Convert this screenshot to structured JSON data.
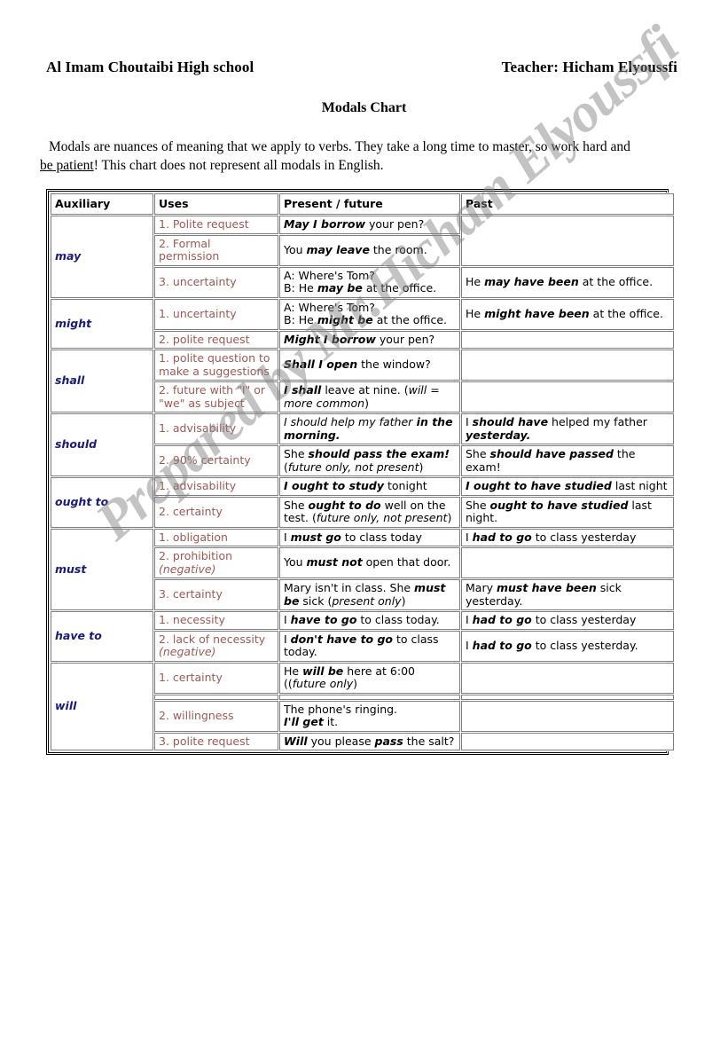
{
  "header": {
    "school": "Al Imam Choutaibi High school",
    "teacher": "Teacher: Hicham Elyoussfi",
    "title": "Modals Chart"
  },
  "intro": {
    "line1": "Modals are nuances of meaning that we apply to verbs. They take a long time to master, so work hard and",
    "line2_underlined": "be patient",
    "line2_rest": "! This chart does not represent all modals in English."
  },
  "watermark": {
    "text": "Prepared by Mr.Hicham Elyoussfi",
    "color": "#828282"
  },
  "colors": {
    "auxiliary_text": "#1a1a7a",
    "uses_text": "#9c5a55",
    "body_text": "#000000",
    "border": "#7d7d7d"
  },
  "table": {
    "columns": [
      "Auxiliary",
      "Uses",
      "Present / future",
      "Past"
    ],
    "groups": [
      {
        "auxiliary": "may",
        "rows": [
          {
            "use": "1. Polite request",
            "present": [
              {
                "t": "May I borrow",
                "s": "bi"
              },
              {
                "t": " your pen?",
                "s": ""
              }
            ],
            "past": [],
            "past_rowspan": 2
          },
          {
            "use": "2. Formal permission",
            "present": [
              {
                "t": "You ",
                "s": ""
              },
              {
                "t": "may leave",
                "s": "bi"
              },
              {
                "t": " the room.",
                "s": ""
              }
            ],
            "past": null
          },
          {
            "use": "3. uncertainty",
            "present": [
              {
                "t": "A: Where's Tom?",
                "s": ""
              },
              {
                "t": "\n",
                "s": "br"
              },
              {
                "t": "B: He ",
                "s": ""
              },
              {
                "t": "may be",
                "s": "bi"
              },
              {
                "t": " at the office.",
                "s": ""
              }
            ],
            "past": [
              {
                "t": "He ",
                "s": ""
              },
              {
                "t": "may have been",
                "s": "bi"
              },
              {
                "t": " at the office.",
                "s": ""
              }
            ]
          }
        ]
      },
      {
        "auxiliary": "might",
        "rows": [
          {
            "use": "1. uncertainty",
            "present": [
              {
                "t": "A: Where's Tom?",
                "s": ""
              },
              {
                "t": "\n",
                "s": "br"
              },
              {
                "t": "B: He ",
                "s": ""
              },
              {
                "t": "might be",
                "s": "bi"
              },
              {
                "t": " at the office.",
                "s": ""
              }
            ],
            "past": [
              {
                "t": "He ",
                "s": ""
              },
              {
                "t": "might have been",
                "s": "bi"
              },
              {
                "t": " at the office.",
                "s": ""
              }
            ]
          },
          {
            "use": "2. polite request",
            "present": [
              {
                "t": "Might I borrow",
                "s": "bi"
              },
              {
                "t": " your pen?",
                "s": ""
              }
            ],
            "past": []
          }
        ]
      },
      {
        "auxiliary": "shall",
        "rows": [
          {
            "use": "1. polite question to make a suggestions",
            "present": [
              {
                "t": "Shall I open",
                "s": "bi"
              },
              {
                "t": " the window?",
                "s": ""
              }
            ],
            "past": []
          },
          {
            "use": "2. future with \"I\" or \"we\" as subject",
            "present": [
              {
                "t": "I shall",
                "s": "bi"
              },
              {
                "t": " leave at nine. (",
                "s": ""
              },
              {
                "t": "will = more common",
                "s": "i"
              },
              {
                "t": ")",
                "s": ""
              }
            ],
            "past": []
          }
        ]
      },
      {
        "auxiliary": "should",
        "rows": [
          {
            "use": "1. advisability",
            "present": [
              {
                "t": "I should help my father",
                "s": "i"
              },
              {
                "t": " in the morning.",
                "s": "b"
              }
            ],
            "past": [
              {
                "t": "I ",
                "s": ""
              },
              {
                "t": "should have",
                "s": "bi"
              },
              {
                "t": " helped my father ",
                "s": ""
              },
              {
                "t": "yesterday.",
                "s": "b"
              }
            ]
          },
          {
            "use": "2. 90% certainty",
            "present": [
              {
                "t": "She ",
                "s": ""
              },
              {
                "t": "should pass the exam!",
                "s": "bi"
              },
              {
                "t": " (",
                "s": ""
              },
              {
                "t": "future only, not present",
                "s": "i"
              },
              {
                "t": ")",
                "s": ""
              }
            ],
            "past": [
              {
                "t": "She ",
                "s": ""
              },
              {
                "t": "should have passed",
                "s": "bi"
              },
              {
                "t": " the exam!",
                "s": ""
              }
            ]
          }
        ]
      },
      {
        "auxiliary": "ought to",
        "rows": [
          {
            "use": "1. advisability",
            "present": [
              {
                "t": "I ought to study",
                "s": "bi"
              },
              {
                "t": " tonight",
                "s": ""
              }
            ],
            "past": [
              {
                "t": "I ought to have studied",
                "s": "bi"
              },
              {
                "t": " last night",
                "s": ""
              }
            ]
          },
          {
            "use": "2. certainty",
            "present": [
              {
                "t": "She ",
                "s": ""
              },
              {
                "t": "ought to do",
                "s": "bi"
              },
              {
                "t": " well on the test. (",
                "s": ""
              },
              {
                "t": "future only, not present",
                "s": "i"
              },
              {
                "t": ")",
                "s": ""
              }
            ],
            "past": [
              {
                "t": "She ",
                "s": ""
              },
              {
                "t": "ought to have studied",
                "s": "bi"
              },
              {
                "t": " last night.",
                "s": ""
              }
            ]
          }
        ]
      },
      {
        "auxiliary": "must",
        "rows": [
          {
            "use": "1. obligation",
            "present": [
              {
                "t": "I ",
                "s": ""
              },
              {
                "t": "must go",
                "s": "bi"
              },
              {
                "t": " to class today",
                "s": ""
              }
            ],
            "past": [
              {
                "t": "I ",
                "s": ""
              },
              {
                "t": "had to go",
                "s": "bi"
              },
              {
                "t": " to class yesterday",
                "s": ""
              }
            ]
          },
          {
            "use": "2. prohibition (negative)",
            "use_italic_tail": "(negative)",
            "present": [
              {
                "t": "You ",
                "s": ""
              },
              {
                "t": "must not",
                "s": "bi"
              },
              {
                "t": " open that door.",
                "s": ""
              }
            ],
            "past": []
          },
          {
            "use": "3. certainty",
            "present": [
              {
                "t": "Mary isn't in class. She ",
                "s": ""
              },
              {
                "t": "must be",
                "s": "bi"
              },
              {
                "t": " sick (",
                "s": ""
              },
              {
                "t": "present only",
                "s": "i"
              },
              {
                "t": ")",
                "s": ""
              }
            ],
            "past": [
              {
                "t": "Mary ",
                "s": ""
              },
              {
                "t": "must have been",
                "s": "bi"
              },
              {
                "t": " sick yesterday.",
                "s": ""
              }
            ]
          }
        ]
      },
      {
        "auxiliary": "have to",
        "rows": [
          {
            "use": "1. necessity",
            "present": [
              {
                "t": "I ",
                "s": ""
              },
              {
                "t": "have to go",
                "s": "bi"
              },
              {
                "t": " to class today.",
                "s": ""
              }
            ],
            "past": [
              {
                "t": "I ",
                "s": ""
              },
              {
                "t": "had to go",
                "s": "bi"
              },
              {
                "t": " to class yesterday",
                "s": ""
              }
            ]
          },
          {
            "use": "2. lack of necessity (negative)",
            "use_italic_tail": "(negative)",
            "present": [
              {
                "t": "I ",
                "s": ""
              },
              {
                "t": "don't have to go",
                "s": "bi"
              },
              {
                "t": " to class today.",
                "s": ""
              }
            ],
            "past": [
              {
                "t": "I ",
                "s": ""
              },
              {
                "t": "had to go",
                "s": "bi"
              },
              {
                "t": " to class yesterday.",
                "s": ""
              }
            ]
          }
        ]
      },
      {
        "auxiliary": "will",
        "rows": [
          {
            "use": "1.  certainty",
            "present": [
              {
                "t": "He ",
                "s": ""
              },
              {
                "t": "will be",
                "s": "bi"
              },
              {
                "t": " here at 6:00",
                "s": ""
              },
              {
                "t": "\n",
                "s": "br"
              },
              {
                "t": "((",
                "s": ""
              },
              {
                "t": "future only",
                "s": "i"
              },
              {
                "t": ")",
                "s": ""
              }
            ],
            "past": []
          },
          {
            "use": "",
            "present": [],
            "past": []
          },
          {
            "use": "2. willingness",
            "present": [
              {
                "t": "The phone's ringing.",
                "s": ""
              },
              {
                "t": "\n",
                "s": "br"
              },
              {
                "t": "I'll get",
                "s": "bi"
              },
              {
                "t": " it.",
                "s": ""
              }
            ],
            "past": []
          },
          {
            "use": "3. polite request",
            "present": [
              {
                "t": "Will",
                "s": "bi"
              },
              {
                "t": " you please ",
                "s": ""
              },
              {
                "t": "pass",
                "s": "bi"
              },
              {
                "t": " the salt?",
                "s": ""
              }
            ],
            "past": []
          }
        ]
      }
    ]
  }
}
